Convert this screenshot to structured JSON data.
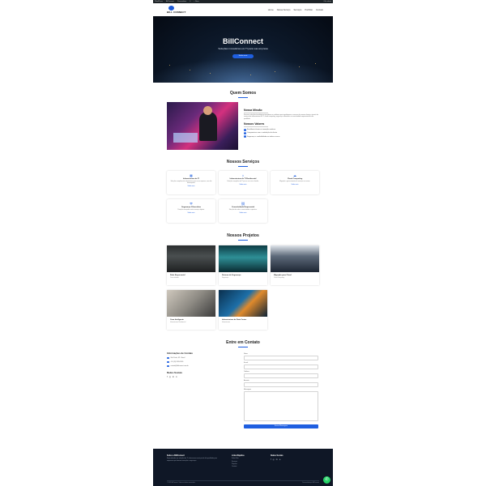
{
  "admin_bar": {
    "left": [
      "WordPress",
      "BillConnect",
      "Personalizar",
      "0",
      "+ Novo"
    ],
    "right": "Olá, admin"
  },
  "header": {
    "logo_text": "BILL CONNECT",
    "nav": [
      "Home",
      "Nossa Serviço",
      "Serviços",
      "Portfólio",
      "Contato"
    ]
  },
  "hero": {
    "title": "BillConnect",
    "subtitle": "Soluções inovadoras em TI para sua empresa",
    "button": "Saiba mais"
  },
  "about": {
    "title": "Quem Somos",
    "mission_title": "Nossa Missão",
    "mission_text": "Fornecer soluções tecnológicas inovadoras e confiáveis que impulsionem o sucesso de nossos clientes, através de serviços de infraestrutura de TI, cloud computing, segurança cibernética e conectividade empresarial de alta qualidade.",
    "values_title": "Nossos Valores",
    "values": [
      "Excelência técnica e inovação contínua",
      "Compromisso com a satisfação do cliente",
      "Segurança e confiabilidade em todos os seus"
    ]
  },
  "services": {
    "title": "Nossos Serviços",
    "items": [
      {
        "icon": "server-icon",
        "title": "Infraestrutura de TI",
        "desc": "Soluções completas de infraestrutura para a sua empresa, com alto desempenho.",
        "link": "Saiba mais"
      },
      {
        "icon": "home-icon",
        "title": "Infraestrutura de TI Residencial",
        "desc": "Soluções completas de TI para a sua casa e família.",
        "link": "Saiba mais"
      },
      {
        "icon": "cloud-icon",
        "title": "Cloud Computing",
        "desc": "Migração e gerenciamento de serviços em nuvem.",
        "link": "Saiba mais"
      },
      {
        "icon": "shield-icon",
        "title": "Segurança Cibernética",
        "desc": "Proteção avançada contra ameaças digitais.",
        "link": "Saiba mais"
      },
      {
        "icon": "network-icon",
        "title": "Conectividade Empresarial",
        "desc": "Soluções de rede e conectividade corporativa.",
        "link": "Saiba mais"
      }
    ]
  },
  "projects": {
    "title": "Nossos Projetos",
    "items": [
      {
        "title": "Rede Empresarial",
        "category": "Conectividade"
      },
      {
        "title": "Sistema de Segurança",
        "category": "Segurança"
      },
      {
        "title": "Migração para Cloud",
        "category": "Cloud Computing"
      },
      {
        "title": "Casa Inteligente",
        "category": "Infraestrutura Residencial"
      },
      {
        "title": "Infraestrutura de Data Center",
        "category": "Infraestrutura"
      }
    ]
  },
  "contact": {
    "title": "Entre em Contato",
    "info_title": "Informações de Contato",
    "address": "São Paulo, SP - Brasil",
    "phone": "+55 (11) 9999-9999",
    "email": "contato@billconnect.com.br",
    "social_title": "Redes Sociais",
    "form": {
      "name_label": "Nome",
      "email_label": "E-mail",
      "phone_label": "Telefone",
      "subject_label": "Assunto",
      "message_label": "Mensagem",
      "submit": "Enviar Mensagem"
    }
  },
  "footer": {
    "about_title": "Sobre a BillConnect",
    "about_text": "Especializada em soluções de TI, oferecemos serviços de alta qualidade para empresas que buscam inovação e segurança.",
    "links_title": "Links Rápidos",
    "links": [
      "Sobre Nós",
      "Serviços",
      "Projetos",
      "Contato"
    ],
    "social_title": "Redes Sociais",
    "copyright": "© 2025 BillConnect. Todos os direitos reservados.",
    "credit": "Desenvolvido por BillConnect"
  },
  "colors": {
    "accent": "#1f5fe0",
    "footer_bg": "#0f1726",
    "whatsapp": "#25d366"
  }
}
